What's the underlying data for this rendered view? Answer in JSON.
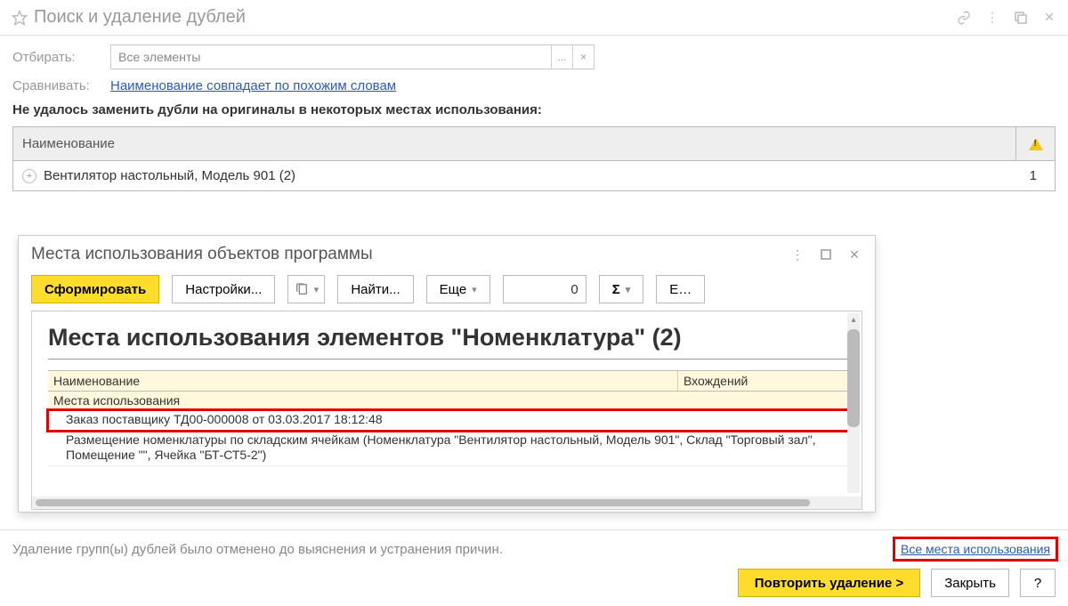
{
  "title": "Поиск и удаление дублей",
  "filter": {
    "label": "Отбирать:",
    "value": "Все элементы",
    "btn_more": "...",
    "btn_clear": "×"
  },
  "compare": {
    "label": "Сравнивать:",
    "link": "Наименование совпадает по похожим словам"
  },
  "error_msg": "Не удалось заменить дубли на оригиналы в некоторых местах использования:",
  "grid": {
    "col_name": "Наименование",
    "row_text": "Вентилятор настольный, Модель 901 (2)",
    "row_count": "1"
  },
  "dialog": {
    "title": "Места использования объектов программы",
    "toolbar": {
      "generate": "Сформировать",
      "settings": "Настройки...",
      "find": "Найти...",
      "more": "Еще",
      "num": "0",
      "sigma": "Σ",
      "extra": "Е…"
    },
    "report": {
      "title": "Места использования элементов \"Номенклатура\" (2)",
      "col_name": "Наименование",
      "col_count": "Вхождений",
      "sub": "Места использования",
      "row1": "Заказ поставщику ТД00-000008 от 03.03.2017 18:12:48",
      "row2": "Размещение номенклатуры по складским ячейкам (Номенклатура \"Вентилятор настольный, Модель 901\", Склад \"Торговый зал\", Помещение \"\", Ячейка \"БТ-СТ5-2\")"
    }
  },
  "footer": {
    "msg": "Удаление групп(ы) дублей было отменено до выяснения и устранения причин.",
    "link": "Все места использования",
    "retry": "Повторить удаление >",
    "close": "Закрыть",
    "help": "?"
  }
}
